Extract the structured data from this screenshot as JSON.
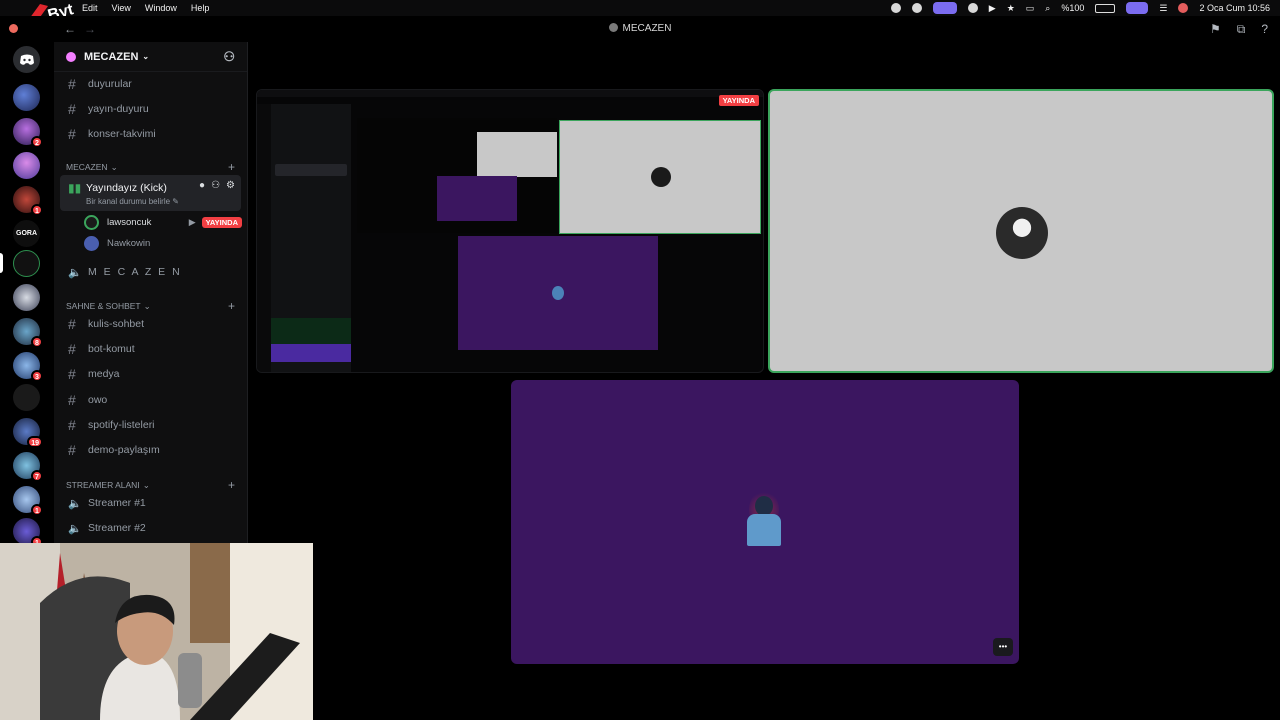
{
  "menubar": {
    "items": [
      "Edit",
      "View",
      "Window",
      "Help"
    ],
    "battery": "%100",
    "datetime": "2 Oca Cum  10:56"
  },
  "titlebar": {
    "title": "MECAZEN"
  },
  "guild": {
    "name": "MECAZEN"
  },
  "channels": {
    "top": [
      "duyurular",
      "yayın-duyuru",
      "konser-takvimi"
    ],
    "cat_mecazen": "MECAZEN",
    "voice_active": {
      "name": "Yayındayız (Kick)",
      "status": "Bir kanal durumu belirle"
    },
    "members": [
      {
        "name": "lawsoncuk",
        "badge": "YAYINDA"
      },
      {
        "name": "Nawkowin"
      }
    ],
    "voice_mecazen": "M E C A Z E N",
    "cat_sahne": "SAHNE & SOHBET",
    "sahne": [
      "kulis-sohbet",
      "bot-komut",
      "medya",
      "owo",
      "spotify-listeleri",
      "demo-paylaşım"
    ],
    "cat_streamer": "STREAMER ALANI",
    "streamer": [
      "Streamer #1",
      "Streamer #2"
    ]
  },
  "servers": {
    "badges": [
      "2",
      "1",
      "8",
      "3",
      "19",
      "7",
      "1",
      "1"
    ],
    "gora_label": "GORA"
  },
  "stage": {
    "live_badge": "YAYINDA",
    "more": "•••"
  },
  "colors": {
    "accent": "#5865f2",
    "live": "#f23f43",
    "stream_purple": "#3b1660",
    "tile_gray": "#c8c8c8",
    "speaking": "#3ba55c"
  }
}
